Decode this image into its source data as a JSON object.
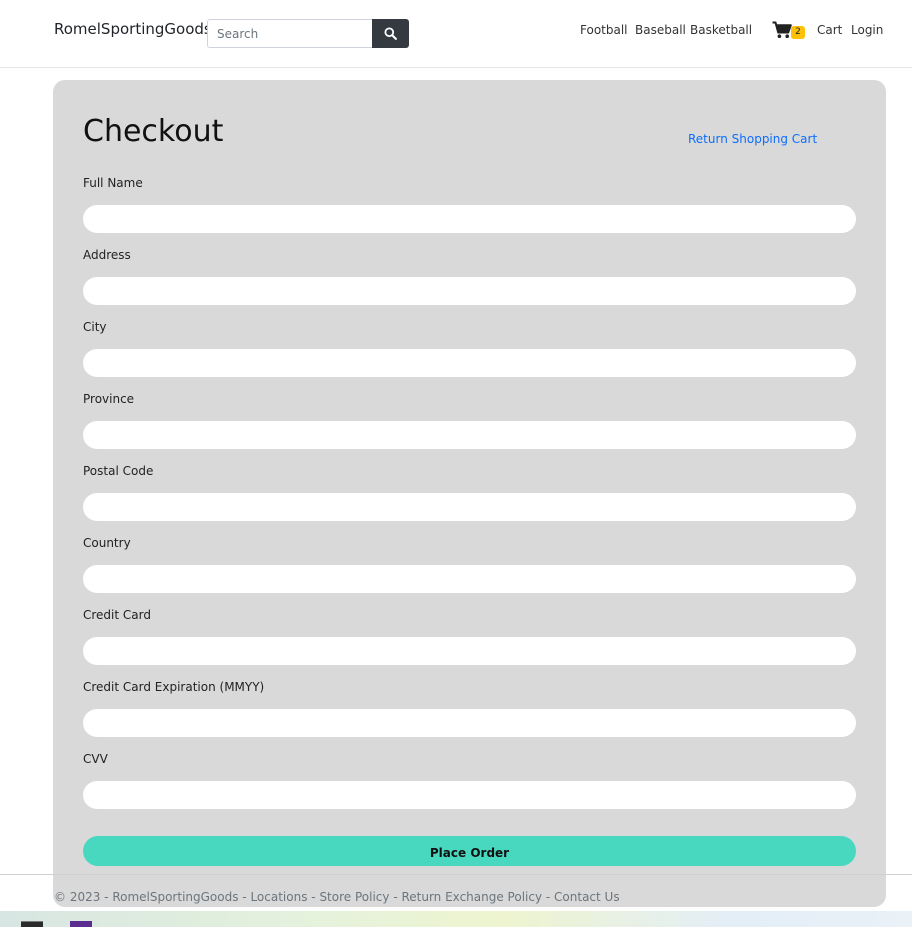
{
  "header": {
    "brand": "RomelSportingGoods",
    "search_placeholder": "Search",
    "nav": {
      "football": "Football",
      "baseball": "Baseball",
      "basketball": "Basketball",
      "cart": "Cart",
      "login": "Login"
    },
    "cart_count": "2"
  },
  "checkout": {
    "title": "Checkout",
    "return_link": "Return Shopping Cart",
    "fields": {
      "full_name": "Full Name",
      "address": "Address",
      "city": "City",
      "province": "Province",
      "postal_code": "Postal Code",
      "country": "Country",
      "credit_card": "Credit Card",
      "expiration": "Credit Card Expiration (MMYY)",
      "cvv": "CVV"
    },
    "submit": "Place Order"
  },
  "footer": {
    "copyright": "© 2023 - RomelSportingGoods",
    "sep": " - ",
    "links": {
      "locations": "Locations",
      "store_policy": "Store Policy",
      "return_policy": "Return Exchange Policy",
      "contact": "Contact Us"
    }
  },
  "colors": {
    "card_bg": "#d9d9d9",
    "accent_button": "#48d8bf",
    "link": "#0d6efd",
    "search_button": "#343a40",
    "badge": "#ffc107"
  },
  "icons": {
    "search": "search-icon",
    "cart": "cart-icon"
  }
}
